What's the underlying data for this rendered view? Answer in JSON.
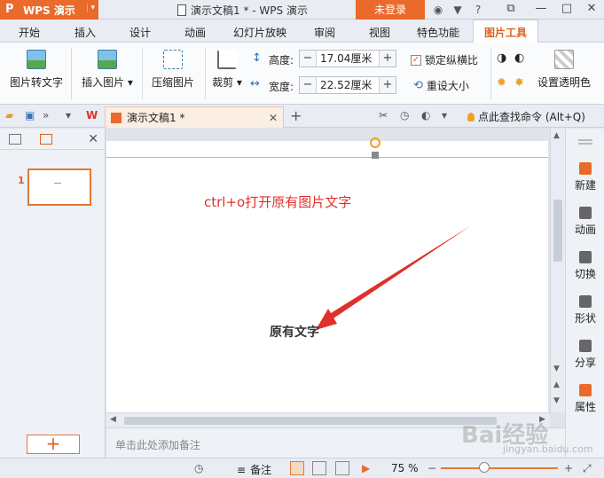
{
  "titlebar": {
    "app_name": "WPS 演示",
    "document_title": "演示文稿1 * - WPS 演示",
    "login_label": "未登录"
  },
  "ribbon_tabs": [
    {
      "label": "开始"
    },
    {
      "label": "插入"
    },
    {
      "label": "设计"
    },
    {
      "label": "动画"
    },
    {
      "label": "幻灯片放映"
    },
    {
      "label": "审阅"
    },
    {
      "label": "视图"
    },
    {
      "label": "特色功能"
    },
    {
      "label": "图片工具",
      "active": true
    }
  ],
  "ribbon": {
    "pic_to_text": "图片转文字",
    "insert_picture": "插入图片",
    "compress_picture": "压缩图片",
    "crop": "裁剪",
    "height_label": "高度:",
    "height_value": "17.04厘米",
    "width_label": "宽度:",
    "width_value": "22.52厘米",
    "lock_ratio": "锁定纵横比",
    "reset_size": "重设大小",
    "set_transparent": "设置透明色"
  },
  "quickbar": {
    "doc_tab_name": "演示文稿1 *",
    "find_command": "点此查找命令 (Alt+Q)"
  },
  "slides_pane": {
    "slide_number": "1"
  },
  "slide": {
    "annotation": "ctrl+o打开原有图片文字",
    "original_text": "原有文字"
  },
  "notes_placeholder": "单击此处添加备注",
  "right_toolbar": [
    {
      "label": "新建",
      "icon": "new-icon"
    },
    {
      "label": "动画",
      "icon": "animation-icon"
    },
    {
      "label": "切换",
      "icon": "transition-icon"
    },
    {
      "label": "形状",
      "icon": "shape-icon"
    },
    {
      "label": "分享",
      "icon": "share-icon"
    },
    {
      "label": "属性",
      "icon": "properties-icon"
    }
  ],
  "statusbar": {
    "notes_label": "备注",
    "zoom": "75 %",
    "zoom_percent": 75
  },
  "watermark": {
    "brand": "Bai经验",
    "url": "jingyan.baidu.com"
  },
  "colors": {
    "accent": "#e96a2b",
    "annotation": "#e0302a"
  }
}
